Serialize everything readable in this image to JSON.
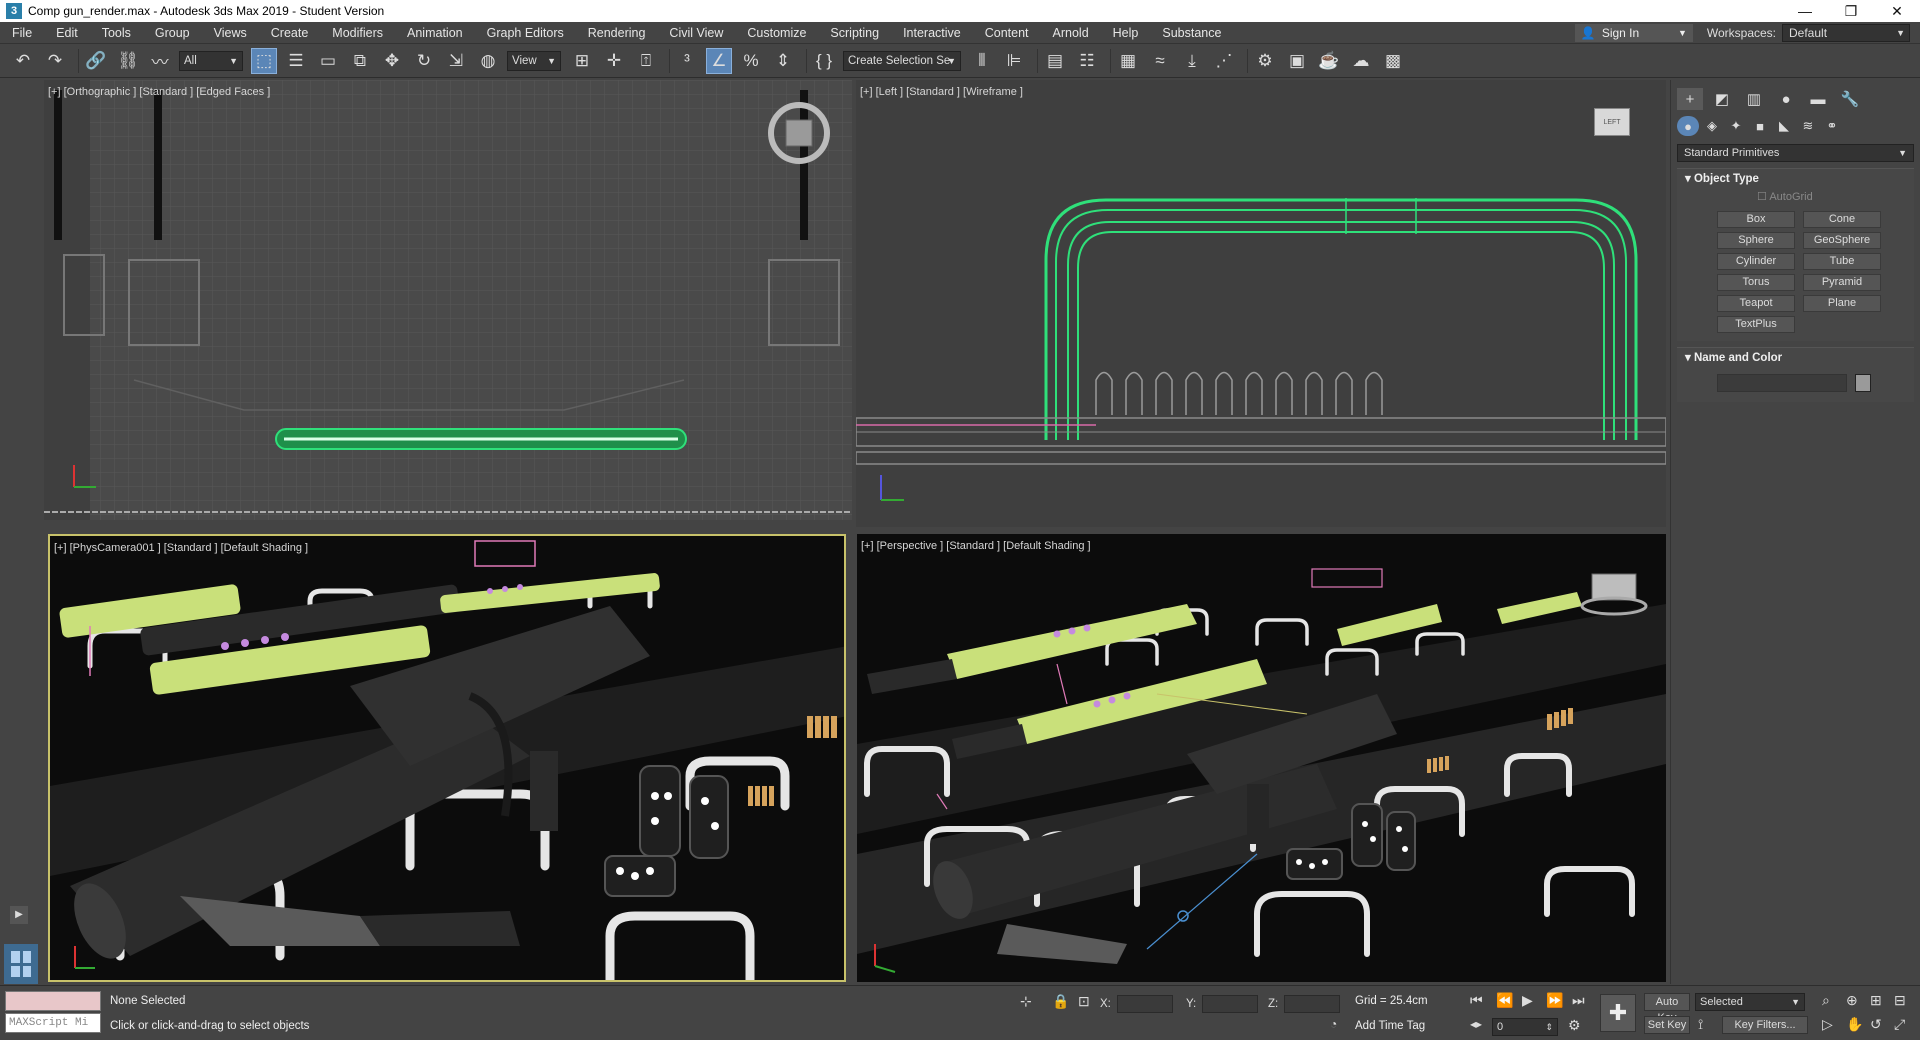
{
  "titlebar": {
    "title": "Comp gun_render.max - Autodesk 3ds Max 2019 - Student Version",
    "app_icon_glyph": "3",
    "minimize": "—",
    "restore": "❐",
    "close": "✕"
  },
  "menubar": {
    "items": [
      "File",
      "Edit",
      "Tools",
      "Group",
      "Views",
      "Create",
      "Modifiers",
      "Animation",
      "Graph Editors",
      "Rendering",
      "Civil View",
      "Customize",
      "Scripting",
      "Interactive",
      "Content",
      "Arnold",
      "Help",
      "Substance"
    ],
    "sign_in": "Sign In",
    "workspaces_label": "Workspaces:",
    "workspaces_value": "Default"
  },
  "toolbar": {
    "selection_filter": "All",
    "reference_coord": "View",
    "named_selection": "Create Selection Se"
  },
  "viewports": {
    "top": "[+] [Orthographic ] [Standard ] [Edged Faces ]",
    "left": "[+] [Left ] [Standard ] [Wireframe ]",
    "camera": "[+] [PhysCamera001 ] [Standard ] [Default Shading ]",
    "perspective": "[+] [Perspective ] [Standard ] [Default Shading ]",
    "viewcube_left_label": "LEFT"
  },
  "command_panel": {
    "category": "Standard Primitives",
    "object_type_title": "Object Type",
    "autogrid": "AutoGrid",
    "primitives": [
      "Box",
      "Cone",
      "Sphere",
      "GeoSphere",
      "Cylinder",
      "Tube",
      "Torus",
      "Pyramid",
      "Teapot",
      "Plane",
      "TextPlus"
    ],
    "name_color_title": "Name and Color"
  },
  "statusbar": {
    "maxscript_placeholder": "MAXScript Mi",
    "selection_status": "None Selected",
    "prompt": "Click or click-and-drag to select objects",
    "x_label": "X:",
    "y_label": "Y:",
    "z_label": "Z:",
    "grid": "Grid = 25.4cm",
    "add_time_tag": "Add Time Tag",
    "auto_key": "Auto Key",
    "set_key": "Set Key",
    "selected": "Selected",
    "key_filters": "Key Filters...",
    "frame": "0"
  },
  "colors": {
    "selection_accent": "#5b86b7",
    "active_viewport_border": "#c8c26a",
    "wireframe_green": "#2fe07a",
    "gun_lime": "#c9e07a"
  }
}
